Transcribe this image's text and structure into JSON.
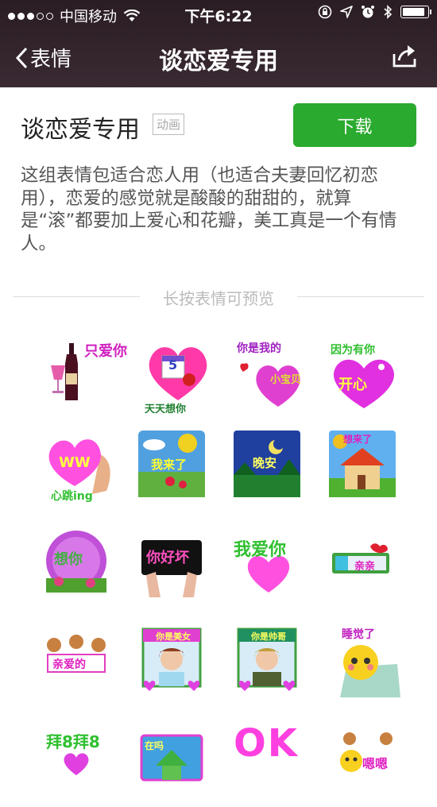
{
  "status_bar": {
    "carrier": "中国移动",
    "time": "下午6:22",
    "signal_dots_filled": 3,
    "signal_dots_total": 5,
    "battery_level": 0.9
  },
  "nav": {
    "back_label": "表情",
    "title": "谈恋爱专用"
  },
  "package": {
    "title": "谈恋爱专用",
    "badge": "动画",
    "download_label": "下载",
    "description": "这组表情包适合恋人用（也适合夫妻回忆初恋用），恋爱的感觉就是酸酸的甜甜的，就算是“滚”都要加上爱心和花瓣，美工真是一个有情人。"
  },
  "divider_text": "长按表情可预览",
  "colors": {
    "download_button": "#2aaa2e",
    "nav_background": "#2f2228"
  },
  "stickers": [
    {
      "name": "wine-love-sticker",
      "text": "只爱你"
    },
    {
      "name": "heart-calendar-sticker",
      "text": "天天想你",
      "extra": "5"
    },
    {
      "name": "baby-heart-sticker",
      "text": "你是我的",
      "extra": "小宝贝"
    },
    {
      "name": "happy-heart-sticker",
      "text": "因为有你",
      "extra": "开心"
    },
    {
      "name": "heartbeat-sticker",
      "text": "心跳ing",
      "extra": "WW"
    },
    {
      "name": "im-here-sticker",
      "text": "我来了"
    },
    {
      "name": "good-night-sticker",
      "text": "晚安"
    },
    {
      "name": "house-sticker",
      "text": "想来了"
    },
    {
      "name": "thinking-of-you-sticker",
      "text": "想你"
    },
    {
      "name": "naughty-sign-sticker",
      "text": "你好坏"
    },
    {
      "name": "i-love-you-sticker",
      "text": "我爱你"
    },
    {
      "name": "kiss-sticker",
      "text": "亲亲"
    },
    {
      "name": "dear-sticker",
      "text": "亲爱的"
    },
    {
      "name": "beauty-frame-sticker",
      "text": "你是美女"
    },
    {
      "name": "handsome-frame-sticker",
      "text": "你是帅哥"
    },
    {
      "name": "sleepy-sticker",
      "text": "睡觉了"
    },
    {
      "name": "bye-bye-sticker",
      "text": "拜8拜8"
    },
    {
      "name": "are-you-there-sticker",
      "text": "在吗"
    },
    {
      "name": "ok-sticker",
      "text": "OK"
    },
    {
      "name": "hmm-sticker",
      "text": "嗯嗯"
    }
  ]
}
